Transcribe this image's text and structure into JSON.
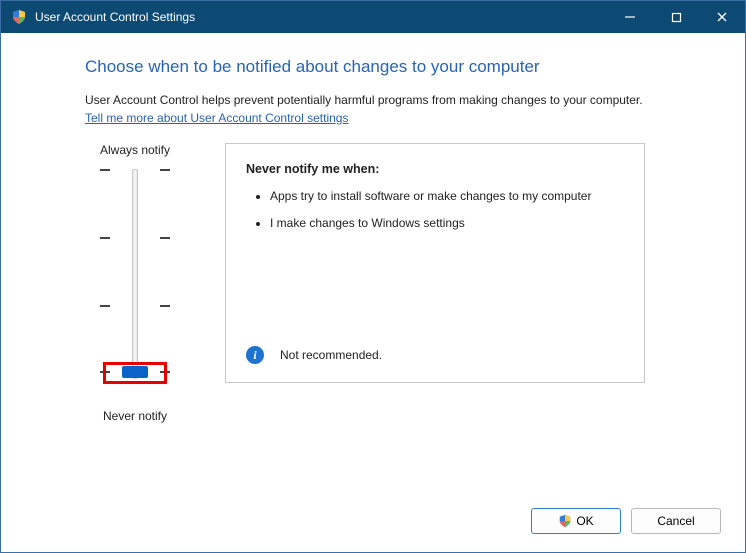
{
  "window": {
    "title": "User Account Control Settings"
  },
  "heading": "Choose when to be notified about changes to your computer",
  "description": "User Account Control helps prevent potentially harmful programs from making changes to your computer.",
  "help_link": "Tell me more about User Account Control settings",
  "slider": {
    "top_label": "Always notify",
    "bottom_label": "Never notify",
    "position_index": 3,
    "levels": 4
  },
  "panel": {
    "title": "Never notify me when:",
    "bullets": [
      "Apps try to install software or make changes to my computer",
      "I make changes to Windows settings"
    ],
    "footer_text": "Not recommended."
  },
  "buttons": {
    "ok": "OK",
    "cancel": "Cancel"
  }
}
